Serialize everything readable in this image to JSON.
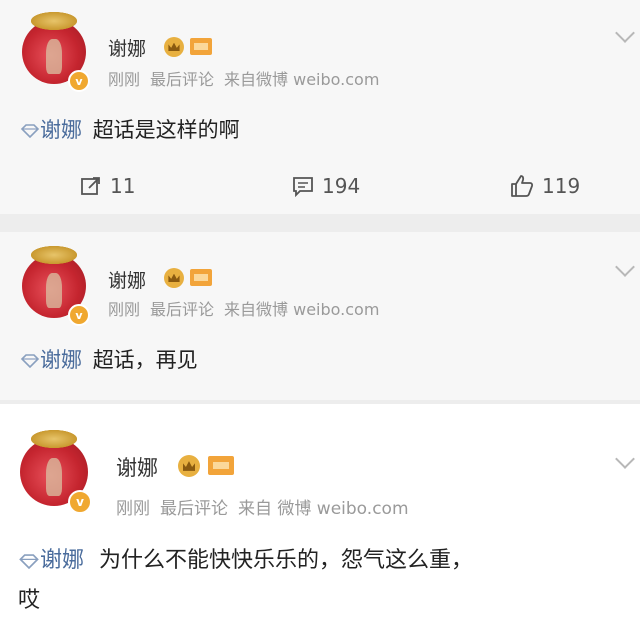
{
  "posts": [
    {
      "author": "谢娜",
      "time": "刚刚",
      "last_comment": "最后评论",
      "source": "来自微博 weibo.com",
      "mention": "谢娜",
      "text": "超话是这样的啊",
      "actions": {
        "repost": "11",
        "comment": "194",
        "like": "119"
      }
    },
    {
      "author": "谢娜",
      "time": "刚刚",
      "last_comment": "最后评论",
      "source": "来自微博 weibo.com",
      "mention": "谢娜",
      "text": "超话，再见"
    },
    {
      "author": "谢娜",
      "time": "刚刚",
      "last_comment": "最后评论",
      "source": "来自 微博 weibo.com",
      "mention": "谢娜",
      "text": "为什么不能快快乐乐的，怨气这么重，",
      "text_line2": "哎"
    }
  ],
  "icons": {
    "verified": "v-badge-icon",
    "crown": "crown-icon",
    "level": "level-badge-icon",
    "mention": "gem-icon",
    "repost": "repost-icon",
    "comment": "comment-icon",
    "like": "thumbs-up-icon",
    "more": "chevron-down-icon"
  },
  "colors": {
    "mention": "#4a6c9c",
    "verified": "#f0a830",
    "meta": "#9a9a9a"
  }
}
